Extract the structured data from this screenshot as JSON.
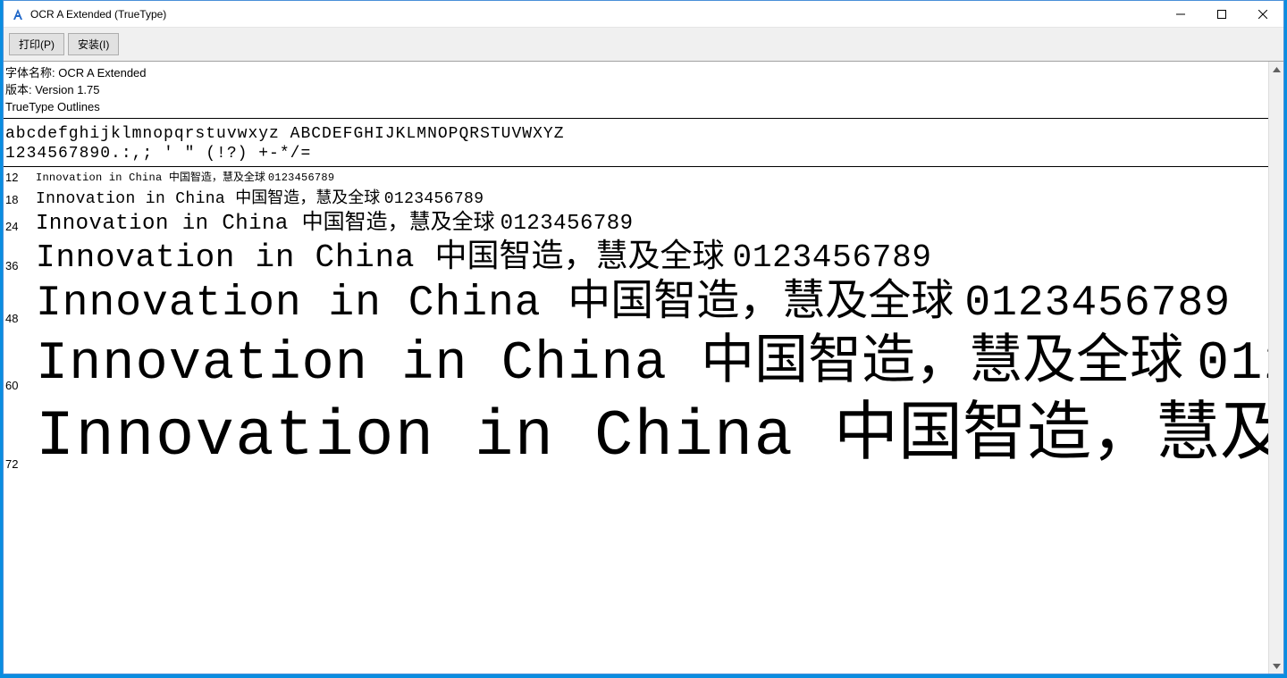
{
  "window": {
    "title": "OCR A Extended (TrueType)"
  },
  "toolbar": {
    "print_label": "打印(P)",
    "install_label": "安装(I)"
  },
  "meta": {
    "font_name_line": "字体名称: OCR A Extended",
    "version_line": "版本: Version 1.75",
    "outline_line": "TrueType Outlines"
  },
  "glyphs": {
    "line1": "abcdefghijklmnopqrstuvwxyz ABCDEFGHIJKLMNOPQRSTUVWXYZ",
    "line2": "1234567890.:,; ' \" (!?) +-*/="
  },
  "sample_phrase": {
    "latin_prefix": "Innovation in China ",
    "cjk": "中国智造，慧及全球 ",
    "digits": "0123456789"
  },
  "samples": [
    {
      "size": 12,
      "label": "12"
    },
    {
      "size": 18,
      "label": "18"
    },
    {
      "size": 24,
      "label": "24"
    },
    {
      "size": 36,
      "label": "36"
    },
    {
      "size": 48,
      "label": "48"
    },
    {
      "size": 60,
      "label": "60"
    },
    {
      "size": 72,
      "label": "72"
    }
  ]
}
